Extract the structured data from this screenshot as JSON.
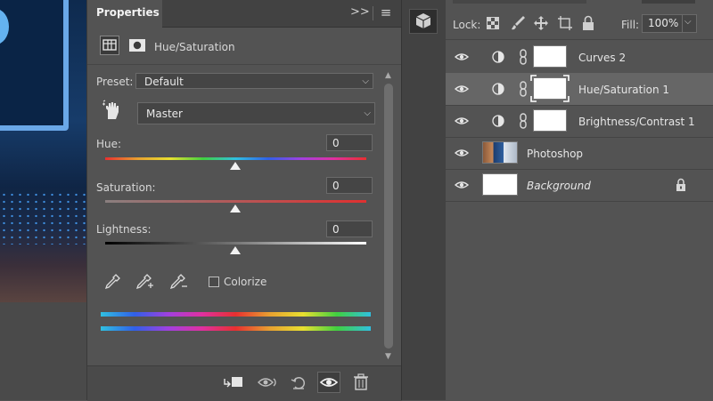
{
  "properties_panel": {
    "tab_title": "Properties",
    "expand_glyph": ">>",
    "menu_glyph": "≡",
    "adjustment_title": "Hue/Saturation",
    "preset_label": "Preset:",
    "preset_value": "Default",
    "channel_value": "Master",
    "sliders": [
      {
        "label": "Hue:",
        "value": "0"
      },
      {
        "label": "Saturation:",
        "value": "0"
      },
      {
        "label": "Lightness:",
        "value": "0"
      }
    ],
    "colorize_label": "Colorize",
    "colorize_checked": false
  },
  "layers_panel": {
    "lock_label": "Lock:",
    "fill_label": "Fill:",
    "fill_value": "100%",
    "layers": [
      {
        "name": "Curves 2",
        "selected": false,
        "italic": false
      },
      {
        "name": "Hue/Saturation 1",
        "selected": true,
        "italic": false
      },
      {
        "name": "Brightness/Contrast 1",
        "selected": false,
        "italic": false
      },
      {
        "name": "Photoshop",
        "selected": false,
        "italic": false
      },
      {
        "name": "Background",
        "selected": false,
        "italic": true
      }
    ]
  },
  "colors": {
    "panel_bg": "#535353",
    "tabbar_bg": "#424242",
    "selected_row": "#666666",
    "text": "#e0e0e0"
  }
}
